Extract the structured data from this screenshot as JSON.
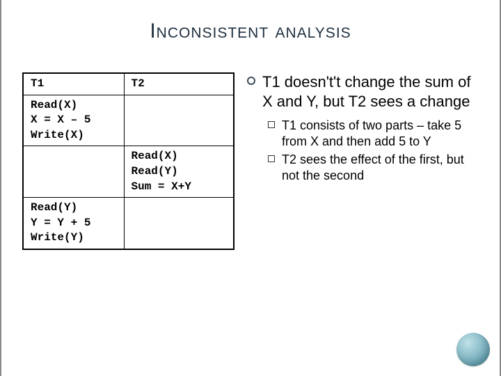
{
  "title": "Inconsistent analysis",
  "table": {
    "headers": [
      "T1",
      "T2"
    ],
    "rows": [
      {
        "c1": "Read(X)\nX = X – 5\nWrite(X)",
        "c2": ""
      },
      {
        "c1": "",
        "c2": "Read(X)\nRead(Y)\nSum = X+Y"
      },
      {
        "c1": "Read(Y)\nY = Y + 5\nWrite(Y)",
        "c2": ""
      }
    ]
  },
  "notes": {
    "lead": "T1 doesn't't change the sum of X and Y, but T2 sees a change",
    "subs": [
      "T1 consists of two parts – take 5 from X and then add 5 to Y",
      "T2 sees the effect of the first, but not the second"
    ]
  }
}
